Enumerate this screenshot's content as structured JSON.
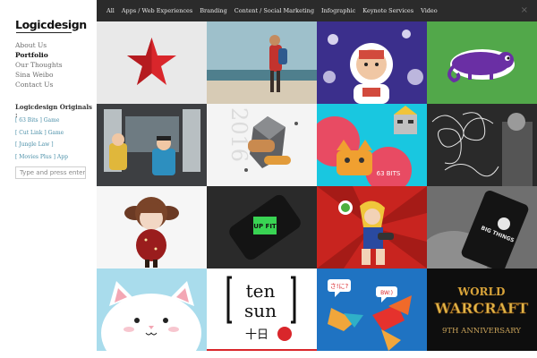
{
  "brand": {
    "logo": "Logicdesign"
  },
  "nav": [
    {
      "label": "About Us",
      "active": false
    },
    {
      "label": "Portfolio",
      "active": true
    },
    {
      "label": "Our Thoughts",
      "active": false
    },
    {
      "label": "Sina Weibo",
      "active": false
    },
    {
      "label": "Contact Us",
      "active": false
    }
  ],
  "originals": {
    "title": "Logicdesign Originals :",
    "items": [
      "[ 63 Bits ] Game",
      "[ Cut Link ] Game",
      "[ Jungle Law ]",
      "[ Movies Plus ] App"
    ]
  },
  "search": {
    "placeholder": "Type and press enter"
  },
  "filters": [
    "All",
    "Apps / Web Experiences",
    "Branding",
    "Content / Social Marketing",
    "Infographic",
    "Keynote Services",
    "Video"
  ],
  "close_label": "×",
  "tiles": {
    "year_text": "2016",
    "bits_label": "63 BITS",
    "upfit_label": "UP FIT",
    "big_things_label": "BIG THINGS",
    "ten_label": "ten",
    "sun_label": "sun",
    "kanji_label": "十日",
    "bubble_left": "さ!に?",
    "bubble_right": "BW:)",
    "world_label": "WORLD",
    "warcraft_label": "WARCRAFT",
    "anniversary_label": "9TH ANNIVERSARY"
  },
  "colors": {
    "topbar": "#2b2b2b",
    "accent_link": "#4a8fa8",
    "star_red": "#d9262b",
    "green_tile": "#52a84a",
    "purple_tile": "#3b2f8c",
    "cyan_tile": "#19c7e0",
    "red_tile": "#c8241f",
    "blue_tile": "#1f73c2"
  }
}
